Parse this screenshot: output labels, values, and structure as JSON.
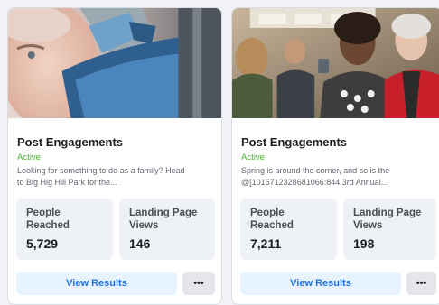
{
  "cards": [
    {
      "title": "Post Engagements",
      "status": "Active",
      "description": "Looking for something to do as a family? Head\nto Big Hig Hill Park for the...",
      "stats": [
        {
          "label": "People\nReached",
          "value": "5,729"
        },
        {
          "label": "Landing Page\nViews",
          "value": "146"
        }
      ],
      "button_label": "View Results",
      "more_label": "•••"
    },
    {
      "title": "Post Engagements",
      "status": "Active",
      "description": "Spring is around the corner, and so is the\n@[1016712328681066:844:3rd Annual...",
      "stats": [
        {
          "label": "People\nReached",
          "value": "7,211"
        },
        {
          "label": "Landing Page\nViews",
          "value": "198"
        }
      ],
      "button_label": "View Results",
      "more_label": "•••"
    }
  ],
  "colors": {
    "status_active": "#42b72a",
    "button_bg": "#e7f3ff",
    "button_text": "#1b74e4"
  }
}
